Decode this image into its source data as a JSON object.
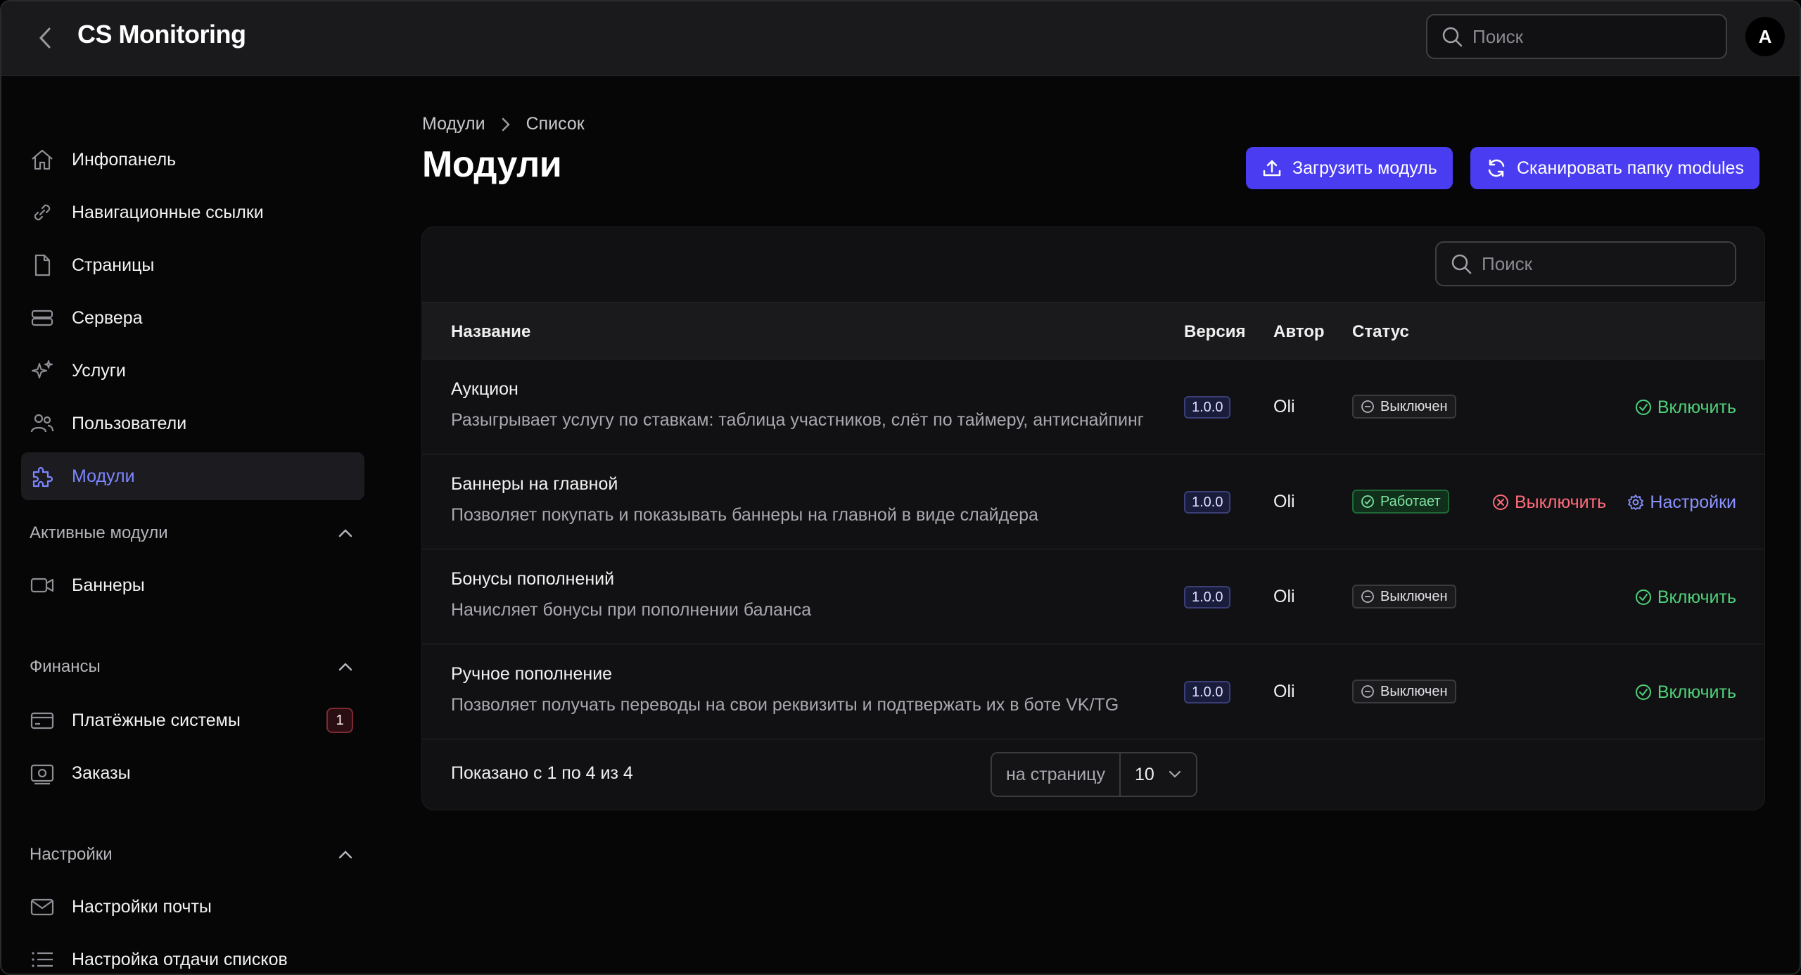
{
  "header": {
    "title": "CS Monitoring",
    "search_placeholder": "Поиск",
    "avatar_letter": "A"
  },
  "sidebar": {
    "items": [
      {
        "label": "Инфопанель",
        "icon": "home-icon"
      },
      {
        "label": "Навигационные ссылки",
        "icon": "link-icon"
      },
      {
        "label": "Страницы",
        "icon": "document-icon"
      },
      {
        "label": "Сервера",
        "icon": "server-icon"
      },
      {
        "label": "Услуги",
        "icon": "sparkles-icon"
      },
      {
        "label": "Пользователи",
        "icon": "users-icon"
      },
      {
        "label": "Модули",
        "icon": "puzzle-icon",
        "active": true
      }
    ],
    "sections": [
      {
        "title": "Активные модули",
        "items": [
          {
            "label": "Баннеры",
            "icon": "video-icon"
          }
        ]
      },
      {
        "title": "Финансы",
        "items": [
          {
            "label": "Платёжные системы",
            "icon": "credit-card-icon",
            "badge": "1"
          },
          {
            "label": "Заказы",
            "icon": "receipt-icon"
          }
        ]
      },
      {
        "title": "Настройки",
        "items": [
          {
            "label": "Настройки почты",
            "icon": "mail-icon"
          },
          {
            "label": "Настройка отдачи списков",
            "icon": "list-icon"
          }
        ]
      }
    ]
  },
  "breadcrumb": [
    "Модули",
    "Список"
  ],
  "page": {
    "title": "Модули",
    "upload_button": "Загрузить модуль",
    "scan_button": "Сканировать папку modules"
  },
  "table": {
    "search_placeholder": "Поиск",
    "columns": [
      "Название",
      "Версия",
      "Автор",
      "Статус"
    ],
    "rows": [
      {
        "name": "Аукцион",
        "description": "Разыгрывает услугу по ставкам: таблица участников, слёт по таймеру, антиснайпинг",
        "version": "1.0.0",
        "author": "Oli",
        "status": "Выключен",
        "enabled": false,
        "action": "Включить"
      },
      {
        "name": "Баннеры на главной",
        "description": "Позволяет покупать и показывать баннеры на главной в виде слайдера",
        "version": "1.0.0",
        "author": "Oli",
        "status": "Работает",
        "enabled": true,
        "action": "Выключить",
        "settings": "Настройки"
      },
      {
        "name": "Бонусы пополнений",
        "description": "Начисляет бонусы при пополнении баланса",
        "version": "1.0.0",
        "author": "Oli",
        "status": "Выключен",
        "enabled": false,
        "action": "Включить"
      },
      {
        "name": "Ручное пополнение",
        "description": "Позволяет получать переводы на свои реквизиты и подтвержать их в боте VK/TG",
        "version": "1.0.0",
        "author": "Oli",
        "status": "Выключен",
        "enabled": false,
        "action": "Включить"
      }
    ],
    "footer": {
      "shown": "Показано с 1 по 4 из 4",
      "per_page_label": "на страницу",
      "per_page_value": "10"
    }
  },
  "colors": {
    "accent": "#4a3cf0",
    "active_nav": "#7c86ff",
    "success": "#4fd17a",
    "danger": "#ff6b7a"
  }
}
